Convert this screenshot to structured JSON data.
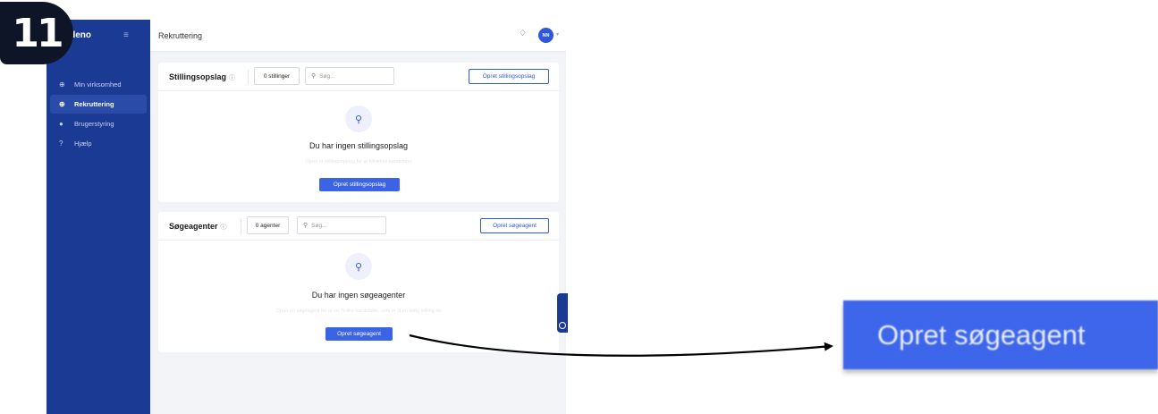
{
  "step": {
    "number": "11"
  },
  "app": {
    "brand": "ndeno",
    "page_title": "Rekruttering",
    "avatar_initials": "NN",
    "sidebar": {
      "items": [
        {
          "label": "Min virksomhed",
          "icon": "building-icon",
          "active": false
        },
        {
          "label": "Rekruttering",
          "icon": "recruit-icon",
          "active": true
        },
        {
          "label": "Brugerstyring",
          "icon": "users-icon",
          "active": false
        },
        {
          "label": "Hjælp",
          "icon": "help-icon",
          "active": false
        }
      ]
    },
    "job_postings": {
      "title": "Stillingsopslag",
      "count_label": "0 stillinger",
      "search_placeholder": "Søg...",
      "create_button": "Opret stillingsopslag",
      "empty_title": "Du har ingen stillingsopslag",
      "empty_subtitle": "Opret et stillingsopslag for at tiltrække kandidater",
      "empty_button": "Opret stillingsopslag"
    },
    "search_agents": {
      "title": "Søgeagenter",
      "count_label": "0 agenter",
      "search_placeholder": "Søg...",
      "create_button": "Opret søgeagent",
      "empty_title": "Du har ingen søgeagenter",
      "empty_subtitle": "Opret en søgeagent for at se, hvilke kandidater, som er til en ledig stilling op",
      "empty_button": "Opret søgeagent"
    }
  },
  "zoom_callout": {
    "label": "Opret søgeagent"
  },
  "colors": {
    "sidebar": "#1b3a94",
    "primary": "#3a63e6",
    "badge": "#0d1526"
  }
}
